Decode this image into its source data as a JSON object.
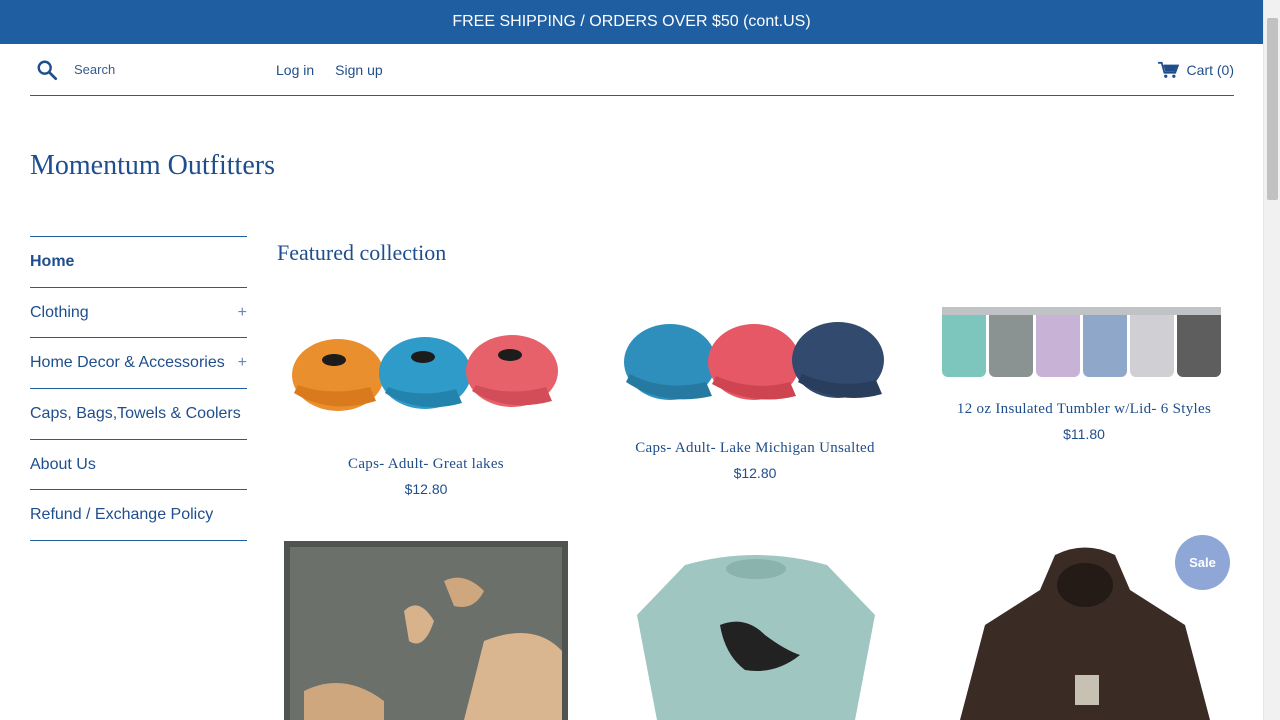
{
  "announcement": "FREE SHIPPING / ORDERS OVER $50 (cont.US)",
  "header": {
    "search_placeholder": "Search",
    "login": "Log in",
    "signup": "Sign up",
    "cart": "Cart (0)"
  },
  "brand": "Momentum Outfitters",
  "sidebar": {
    "items": [
      {
        "label": "Home",
        "expand": ""
      },
      {
        "label": "Clothing",
        "expand": "+"
      },
      {
        "label": "Home Decor & Accessories",
        "expand": "+"
      },
      {
        "label": "Caps, Bags,Towels & Coolers",
        "expand": ""
      },
      {
        "label": "About Us",
        "expand": ""
      },
      {
        "label": "Refund / Exchange Policy",
        "expand": ""
      }
    ]
  },
  "featured": {
    "heading": "Featured collection",
    "products": [
      {
        "title": "Caps- Adult- Great lakes",
        "price": "$12.80"
      },
      {
        "title": "Caps- Adult- Lake Michigan Unsalted",
        "price": "$12.80"
      },
      {
        "title": "12 oz Insulated Tumbler w/Lid- 6 Styles",
        "price": "$11.80"
      }
    ],
    "sale_badge": "Sale"
  },
  "colors": {
    "brand_blue": "#1f5ea0",
    "text_blue": "#1f4e8c",
    "sale_badge": "#8ea7d6"
  }
}
